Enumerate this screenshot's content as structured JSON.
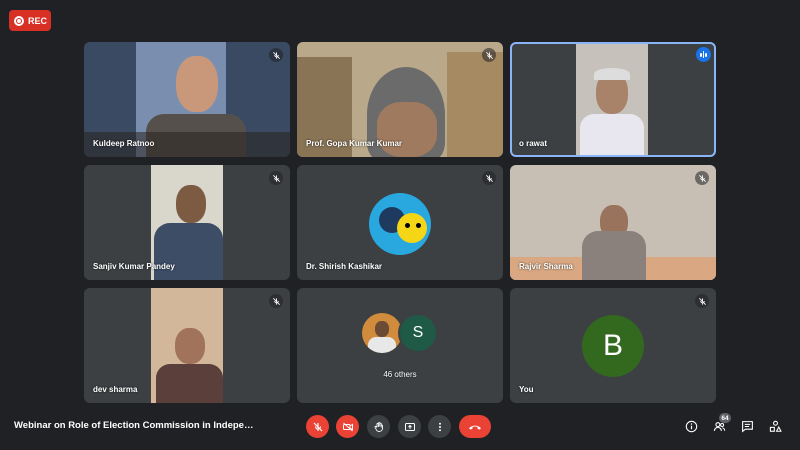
{
  "recording": {
    "label": "REC"
  },
  "tiles": [
    {
      "name": "Kuldeep Ratnoo",
      "muted": true
    },
    {
      "name": "Prof. Gopa Kumar Kumar",
      "muted": true
    },
    {
      "name": "o rawat",
      "speaking": true
    },
    {
      "name": "Sanjiv Kumar Pandey",
      "muted": true
    },
    {
      "name": "Dr. Shirish Kashikar",
      "muted": true
    },
    {
      "name": "Rajvir Sharma",
      "muted": true
    },
    {
      "name": "dev sharma",
      "muted": true
    },
    {
      "name": "46 others",
      "avatar_letter": "S"
    },
    {
      "name": "You",
      "muted": true,
      "avatar_letter": "B"
    }
  ],
  "footer": {
    "meeting_title": "Webinar on Role of Election Commission in Indepen...",
    "participant_count": "64"
  },
  "colors": {
    "background": "#202124",
    "tile": "#3c4043",
    "danger": "#ea4335",
    "active_outline": "#8ab4f8",
    "speaking": "#1a73e8",
    "avatar_you": "#33691e",
    "avatar_s": "#1e5a46"
  },
  "icons": [
    "record-icon",
    "mic-off-icon",
    "camera-off-icon",
    "hand-icon",
    "present-icon",
    "more-icon",
    "end-call-icon",
    "info-icon",
    "people-icon",
    "chat-icon",
    "activities-icon"
  ]
}
